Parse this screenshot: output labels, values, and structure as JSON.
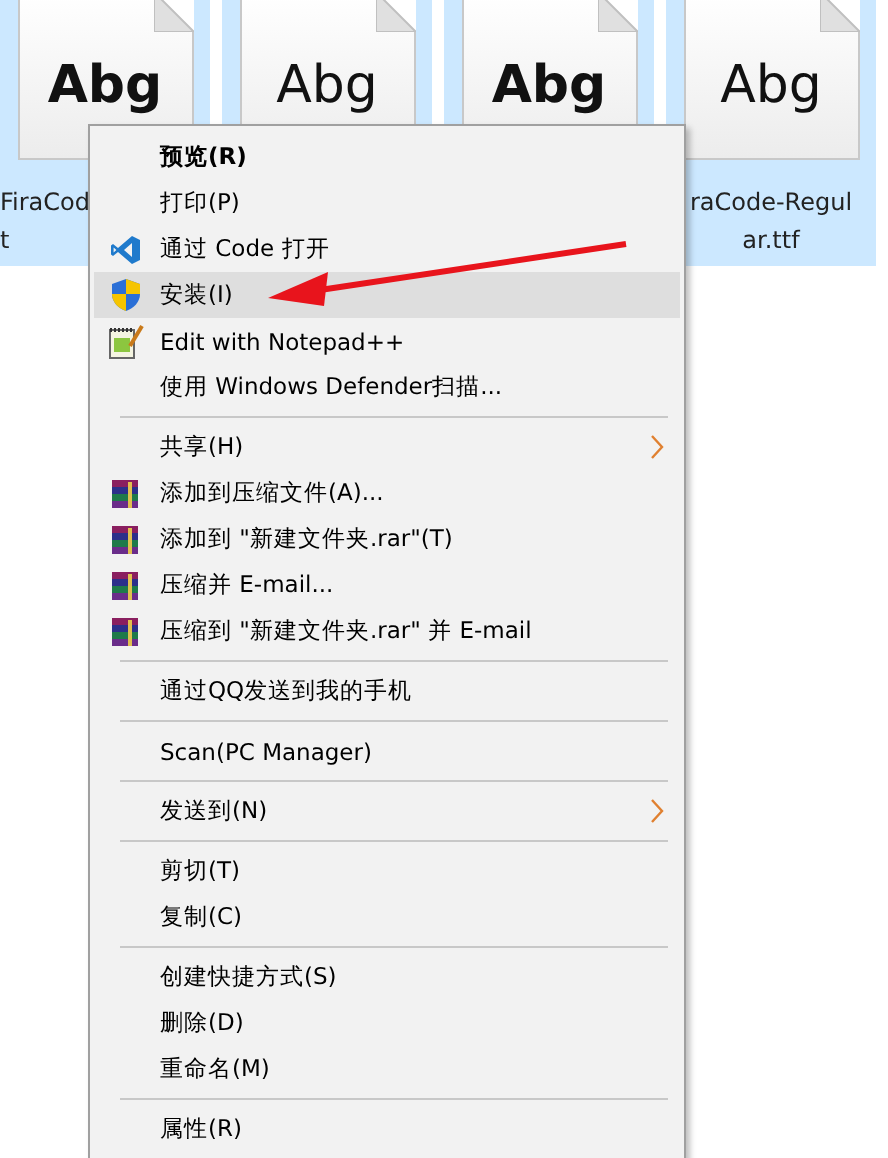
{
  "files": [
    {
      "preview": "Abg",
      "bold": true,
      "label_lines": [
        "FiraCod",
        "t"
      ]
    },
    {
      "preview": "Abg",
      "bold": false
    },
    {
      "preview": "Abg",
      "bold": true
    },
    {
      "preview": "Abg",
      "bold": false,
      "label_lines": [
        "raCode-Regul",
        "ar.ttf"
      ]
    }
  ],
  "context_menu": {
    "groups": [
      [
        {
          "label": "预览(R)",
          "kind": "plain",
          "default": true,
          "selected": false,
          "submenu": false
        },
        {
          "label": "打印(P)",
          "kind": "plain",
          "default": false,
          "selected": false,
          "submenu": false
        },
        {
          "label": "通过 Code 打开",
          "kind": "editor",
          "default": false,
          "selected": false,
          "submenu": false
        },
        {
          "label": "安装(I)",
          "kind": "admin",
          "default": false,
          "selected": true,
          "submenu": false
        },
        {
          "label": "Edit with Notepad++",
          "kind": "notepad",
          "default": false,
          "selected": false,
          "submenu": false
        },
        {
          "label": "使用 Windows Defender扫描...",
          "kind": "plain",
          "default": false,
          "selected": false,
          "submenu": false
        }
      ],
      [
        {
          "label": "共享(H)",
          "kind": "plain",
          "default": false,
          "selected": false,
          "submenu": true
        },
        {
          "label": "添加到压缩文件(A)...",
          "kind": "archive",
          "default": false,
          "selected": false,
          "submenu": false
        },
        {
          "label": "添加到 \"新建文件夹.rar\"(T)",
          "kind": "archive",
          "default": false,
          "selected": false,
          "submenu": false
        },
        {
          "label": "压缩并 E-mail...",
          "kind": "archive",
          "default": false,
          "selected": false,
          "submenu": false
        },
        {
          "label": "压缩到 \"新建文件夹.rar\" 并 E-mail",
          "kind": "archive",
          "default": false,
          "selected": false,
          "submenu": false
        }
      ],
      [
        {
          "label": "通过QQ发送到我的手机",
          "kind": "plain",
          "default": false,
          "selected": false,
          "submenu": false
        }
      ],
      [
        {
          "label": "Scan(PC Manager)",
          "kind": "plain",
          "default": false,
          "selected": false,
          "submenu": false
        }
      ],
      [
        {
          "label": "发送到(N)",
          "kind": "plain",
          "default": false,
          "selected": false,
          "submenu": true
        }
      ],
      [
        {
          "label": "剪切(T)",
          "kind": "plain",
          "default": false,
          "selected": false,
          "submenu": false
        },
        {
          "label": "复制(C)",
          "kind": "plain",
          "default": false,
          "selected": false,
          "submenu": false
        }
      ],
      [
        {
          "label": "创建快捷方式(S)",
          "kind": "plain",
          "default": false,
          "selected": false,
          "submenu": false
        },
        {
          "label": "删除(D)",
          "kind": "plain",
          "default": false,
          "selected": false,
          "submenu": false
        },
        {
          "label": "重命名(M)",
          "kind": "plain",
          "default": false,
          "selected": false,
          "submenu": false
        }
      ],
      [
        {
          "label": "属性(R)",
          "kind": "plain",
          "default": false,
          "selected": false,
          "submenu": false
        }
      ]
    ]
  },
  "annotation": {
    "kind": "arrow"
  }
}
